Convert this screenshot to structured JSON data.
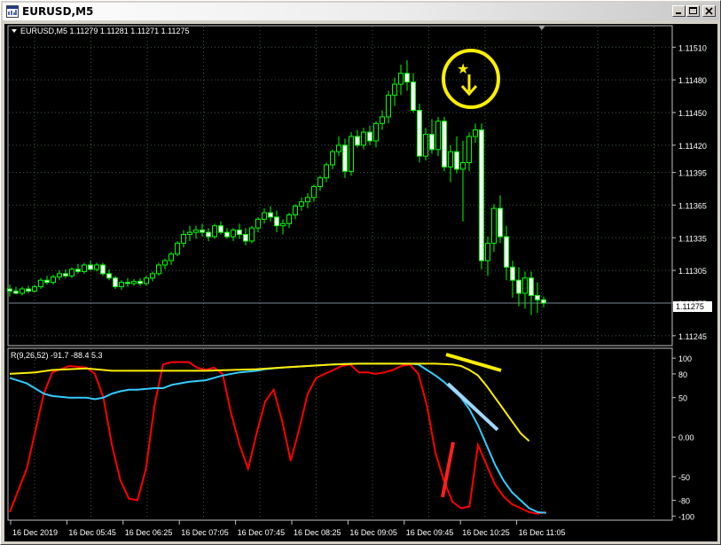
{
  "window": {
    "title": "EURUSD,M5"
  },
  "chart_data": [
    {
      "type": "candlestick",
      "header": "EURUSD,M5  1.11279 1.11281 1.11271 1.11275",
      "y_ticks": [
        "1.11510",
        "1.11480",
        "1.11450",
        "1.11420",
        "1.11395",
        "1.11365",
        "1.11335",
        "1.11305",
        "1.11275",
        "1.11245"
      ],
      "ylim": [
        1.1124,
        1.1152
      ],
      "current_price": "1.11275",
      "colors": {
        "bull": "#000000",
        "bear": "#ffffff",
        "outline": "#00ff00",
        "bid_line": "#778899"
      },
      "candles": [
        [
          1.11288,
          1.11292,
          1.11281,
          1.11286
        ],
        [
          1.11286,
          1.1129,
          1.11283,
          1.11284
        ],
        [
          1.11284,
          1.1129,
          1.11282,
          1.11288
        ],
        [
          1.11288,
          1.11291,
          1.11284,
          1.11286
        ],
        [
          1.11286,
          1.11292,
          1.11285,
          1.1129
        ],
        [
          1.1129,
          1.11298,
          1.11288,
          1.11296
        ],
        [
          1.11296,
          1.113,
          1.11292,
          1.11294
        ],
        [
          1.11294,
          1.11301,
          1.11292,
          1.11299
        ],
        [
          1.11299,
          1.11305,
          1.11296,
          1.11302
        ],
        [
          1.11302,
          1.11306,
          1.11298,
          1.113
        ],
        [
          1.113,
          1.11308,
          1.11298,
          1.11306
        ],
        [
          1.11306,
          1.11311,
          1.11302,
          1.11304
        ],
        [
          1.11304,
          1.11312,
          1.11302,
          1.1131
        ],
        [
          1.1131,
          1.11314,
          1.11305,
          1.11306
        ],
        [
          1.11306,
          1.11312,
          1.11304,
          1.1131
        ],
        [
          1.1131,
          1.11312,
          1.113,
          1.11302
        ],
        [
          1.11302,
          1.11306,
          1.11296,
          1.11298
        ],
        [
          1.11298,
          1.113,
          1.11288,
          1.1129
        ],
        [
          1.1129,
          1.11296,
          1.11287,
          1.11294
        ],
        [
          1.11294,
          1.11298,
          1.1129,
          1.11293
        ],
        [
          1.11293,
          1.11297,
          1.11291,
          1.11295
        ],
        [
          1.11295,
          1.11298,
          1.11291,
          1.11293
        ],
        [
          1.11293,
          1.113,
          1.11291,
          1.11298
        ],
        [
          1.11298,
          1.11304,
          1.11295,
          1.11302
        ],
        [
          1.11302,
          1.11312,
          1.113,
          1.1131
        ],
        [
          1.1131,
          1.11316,
          1.11306,
          1.11314
        ],
        [
          1.11314,
          1.11322,
          1.1131,
          1.1132
        ],
        [
          1.1132,
          1.11332,
          1.11318,
          1.1133
        ],
        [
          1.1133,
          1.11342,
          1.11326,
          1.11338
        ],
        [
          1.11338,
          1.11346,
          1.11332,
          1.1134
        ],
        [
          1.1134,
          1.11346,
          1.11334,
          1.11342
        ],
        [
          1.11342,
          1.11348,
          1.11336,
          1.1134
        ],
        [
          1.1134,
          1.11344,
          1.11332,
          1.11336
        ],
        [
          1.11336,
          1.11348,
          1.11334,
          1.11346
        ],
        [
          1.11346,
          1.1135,
          1.11338,
          1.1134
        ],
        [
          1.1134,
          1.11344,
          1.11334,
          1.11336
        ],
        [
          1.11336,
          1.11344,
          1.11332,
          1.11342
        ],
        [
          1.11342,
          1.11348,
          1.11334,
          1.11338
        ],
        [
          1.11338,
          1.11344,
          1.11328,
          1.11332
        ],
        [
          1.11332,
          1.11346,
          1.1133,
          1.11344
        ],
        [
          1.11344,
          1.11354,
          1.1134,
          1.11352
        ],
        [
          1.11352,
          1.11362,
          1.11348,
          1.11358
        ],
        [
          1.11358,
          1.11364,
          1.1135,
          1.11354
        ],
        [
          1.11354,
          1.1136,
          1.1134,
          1.11346
        ],
        [
          1.11346,
          1.11352,
          1.11338,
          1.11348
        ],
        [
          1.11348,
          1.11358,
          1.11344,
          1.11356
        ],
        [
          1.11356,
          1.11366,
          1.11352,
          1.11364
        ],
        [
          1.11364,
          1.11372,
          1.1136,
          1.11368
        ],
        [
          1.11368,
          1.11376,
          1.11362,
          1.11372
        ],
        [
          1.11372,
          1.11384,
          1.11368,
          1.11382
        ],
        [
          1.11382,
          1.11392,
          1.11378,
          1.1139
        ],
        [
          1.1139,
          1.11404,
          1.11386,
          1.11402
        ],
        [
          1.11402,
          1.11416,
          1.11398,
          1.11414
        ],
        [
          1.11414,
          1.11428,
          1.1141,
          1.1142
        ],
        [
          1.1142,
          1.11426,
          1.1139,
          1.11396
        ],
        [
          1.11396,
          1.11432,
          1.11392,
          1.11428
        ],
        [
          1.11428,
          1.11434,
          1.11418,
          1.1142
        ],
        [
          1.1142,
          1.11436,
          1.11416,
          1.11432
        ],
        [
          1.11432,
          1.11438,
          1.1142,
          1.11424
        ],
        [
          1.11424,
          1.11442,
          1.11418,
          1.1144
        ],
        [
          1.1144,
          1.11452,
          1.11434,
          1.11446
        ],
        [
          1.11446,
          1.1147,
          1.1144,
          1.11466
        ],
        [
          1.11466,
          1.11482,
          1.11456,
          1.11476
        ],
        [
          1.11476,
          1.11494,
          1.11466,
          1.11486
        ],
        [
          1.11486,
          1.11498,
          1.1147,
          1.11478
        ],
        [
          1.11478,
          1.11486,
          1.1145,
          1.11452
        ],
        [
          1.11452,
          1.11458,
          1.11404,
          1.1141
        ],
        [
          1.1141,
          1.11436,
          1.11406,
          1.1143
        ],
        [
          1.1143,
          1.11444,
          1.11412,
          1.11416
        ],
        [
          1.11416,
          1.11446,
          1.1141,
          1.11442
        ],
        [
          1.11442,
          1.11446,
          1.11396,
          1.114
        ],
        [
          1.114,
          1.1142,
          1.11386,
          1.11414
        ],
        [
          1.11414,
          1.11428,
          1.11394,
          1.11398
        ],
        [
          1.11398,
          1.11424,
          1.1135,
          1.11404
        ],
        [
          1.11404,
          1.11432,
          1.11396,
          1.11428
        ],
        [
          1.11428,
          1.1144,
          1.11422,
          1.11434
        ],
        [
          1.11434,
          1.1144,
          1.11306,
          1.11314
        ],
        [
          1.11314,
          1.11336,
          1.113,
          1.1133
        ],
        [
          1.1133,
          1.11366,
          1.11322,
          1.11362
        ],
        [
          1.11362,
          1.11374,
          1.1133,
          1.11336
        ],
        [
          1.11336,
          1.11346,
          1.11296,
          1.11308
        ],
        [
          1.11308,
          1.11314,
          1.1128,
          1.11296
        ],
        [
          1.11296,
          1.11308,
          1.11272,
          1.11284
        ],
        [
          1.11284,
          1.11304,
          1.1127,
          1.11298
        ],
        [
          1.11298,
          1.11304,
          1.11264,
          1.11282
        ],
        [
          1.11282,
          1.11294,
          1.11266,
          1.11278
        ],
        [
          1.11278,
          1.11281,
          1.11271,
          1.11275
        ]
      ]
    },
    {
      "type": "line",
      "header": "R(9,26,52) -91.7 -88.4 5.3",
      "y_ticks": [
        "100",
        "80",
        "50",
        "0.00",
        "-50",
        "-80",
        "-100"
      ],
      "ylim": [
        -103,
        108
      ],
      "x_ticks": [
        "16 Dec 2019",
        "16 Dec 05:45",
        "16 Dec 06:25",
        "16 Dec 07:05",
        "16 Dec 07:45",
        "16 Dec 08:25",
        "16 Dec 09:05",
        "16 Dec 09:45",
        "16 Dec 10:25",
        "16 Dec 11:05"
      ],
      "series": [
        {
          "color": "#ff0000",
          "points": [
            [
              0,
              -95
            ],
            [
              4,
              -40
            ],
            [
              8,
              55
            ],
            [
              10,
              82
            ],
            [
              14,
              90
            ],
            [
              18,
              88
            ],
            [
              20,
              80
            ],
            [
              22,
              50
            ],
            [
              24,
              -10
            ],
            [
              26,
              -55
            ],
            [
              28,
              -78
            ],
            [
              30,
              -80
            ],
            [
              32,
              -40
            ],
            [
              34,
              40
            ],
            [
              36,
              92
            ],
            [
              38,
              95
            ],
            [
              42,
              95
            ],
            [
              44,
              88
            ],
            [
              46,
              85
            ],
            [
              48,
              88
            ],
            [
              50,
              80
            ],
            [
              52,
              30
            ],
            [
              54,
              -10
            ],
            [
              56,
              -40
            ],
            [
              58,
              5
            ],
            [
              60,
              45
            ],
            [
              62,
              60
            ],
            [
              64,
              20
            ],
            [
              66,
              -30
            ],
            [
              68,
              10
            ],
            [
              70,
              55
            ],
            [
              72,
              75
            ],
            [
              74,
              80
            ],
            [
              76,
              85
            ],
            [
              78,
              90
            ],
            [
              80,
              92
            ],
            [
              82,
              82
            ],
            [
              84,
              82
            ],
            [
              86,
              80
            ],
            [
              88,
              82
            ],
            [
              90,
              85
            ],
            [
              92,
              90
            ],
            [
              94,
              92
            ],
            [
              96,
              80
            ],
            [
              98,
              40
            ],
            [
              100,
              -20
            ],
            [
              102,
              -55
            ],
            [
              104,
              -82
            ],
            [
              106,
              -90
            ],
            [
              108,
              -88
            ],
            [
              110,
              -10
            ],
            [
              112,
              -35
            ],
            [
              114,
              -60
            ],
            [
              116,
              -75
            ],
            [
              118,
              -85
            ],
            [
              120,
              -90
            ],
            [
              122,
              -95
            ],
            [
              124,
              -97
            ],
            [
              126,
              -95
            ]
          ]
        },
        {
          "color": "#33ccff",
          "points": [
            [
              0,
              75
            ],
            [
              4,
              68
            ],
            [
              8,
              55
            ],
            [
              10,
              52
            ],
            [
              14,
              50
            ],
            [
              18,
              50
            ],
            [
              20,
              48
            ],
            [
              22,
              50
            ],
            [
              24,
              55
            ],
            [
              26,
              58
            ],
            [
              28,
              60
            ],
            [
              30,
              60
            ],
            [
              34,
              62
            ],
            [
              36,
              62
            ],
            [
              38,
              66
            ],
            [
              40,
              68
            ],
            [
              42,
              70
            ],
            [
              46,
              72
            ],
            [
              50,
              78
            ],
            [
              54,
              82
            ],
            [
              58,
              84
            ],
            [
              60,
              86
            ],
            [
              64,
              88
            ],
            [
              70,
              90
            ],
            [
              76,
              92
            ],
            [
              80,
              93
            ],
            [
              86,
              93
            ],
            [
              90,
              93
            ],
            [
              94,
              93
            ],
            [
              96,
              92
            ],
            [
              98,
              85
            ],
            [
              100,
              78
            ],
            [
              102,
              70
            ],
            [
              104,
              60
            ],
            [
              106,
              50
            ],
            [
              108,
              35
            ],
            [
              110,
              15
            ],
            [
              112,
              -10
            ],
            [
              114,
              -35
            ],
            [
              116,
              -55
            ],
            [
              118,
              -70
            ],
            [
              120,
              -80
            ],
            [
              122,
              -90
            ],
            [
              124,
              -95
            ],
            [
              126,
              -96
            ]
          ]
        },
        {
          "color": "#ffee00",
          "points": [
            [
              0,
              80
            ],
            [
              6,
              82
            ],
            [
              10,
              85
            ],
            [
              14,
              86
            ],
            [
              18,
              87
            ],
            [
              20,
              86
            ],
            [
              24,
              84
            ],
            [
              28,
              84
            ],
            [
              34,
              84
            ],
            [
              40,
              84
            ],
            [
              46,
              84
            ],
            [
              52,
              85
            ],
            [
              58,
              86
            ],
            [
              64,
              88
            ],
            [
              70,
              90
            ],
            [
              76,
              92
            ],
            [
              82,
              93
            ],
            [
              88,
              93
            ],
            [
              94,
              93
            ],
            [
              100,
              93
            ],
            [
              104,
              92
            ],
            [
              106,
              90
            ],
            [
              108,
              85
            ],
            [
              110,
              78
            ],
            [
              112,
              65
            ],
            [
              114,
              50
            ],
            [
              116,
              35
            ],
            [
              118,
              20
            ],
            [
              120,
              5
            ],
            [
              122,
              -5
            ]
          ]
        }
      ]
    }
  ],
  "annotations": {
    "star": "★",
    "arrow": "down-arrow"
  }
}
